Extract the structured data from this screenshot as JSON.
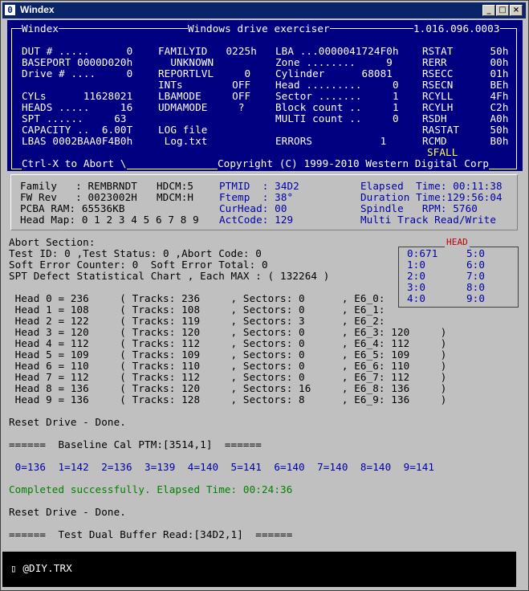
{
  "window": {
    "title": "Windex"
  },
  "header": {
    "app": "Windex",
    "subtitle": "Windows drive exerciser",
    "version": "1.016.096.0003",
    "footer_left": "Ctrl-X to Abort \\",
    "footer_right": "Copyright (C) 1999-2010 Western Digital Corp"
  },
  "blue_rows": [
    [
      "DUT # .....      0",
      "FAMILYID   0225h",
      "LBA ...0000041724F0h",
      "RSTAT      50h"
    ],
    [
      "BASEPORT 0000D020h",
      "  UNKNOWN",
      "Zone ........     9",
      "RERR       00h"
    ],
    [
      "Drive # ....     0",
      "REPORTLVL     0",
      "Cylinder      68081",
      "RSECC      01h"
    ],
    [
      "",
      "INTs        OFF",
      "Head .........     0",
      "RSECN      BEh"
    ],
    [
      "CYLs      11628021",
      "LBAMODE     OFF",
      "Sector .......     1",
      "RCYLL      4Fh"
    ],
    [
      "HEADS .....     16",
      "UDMAMODE     ?",
      "Block count ..     1",
      "RCYLH      C2h"
    ],
    [
      "SPT ......     63",
      "",
      "MULTI count ..     0",
      "RSDH       A0h"
    ],
    [
      "CAPACITY ..  6.00T",
      "LOG file",
      "",
      "RASTAT     50h"
    ],
    [
      "LBAS 0002BAA0F4B0h",
      " Log.txt",
      "ERRORS           1",
      "RCMD       B0h"
    ]
  ],
  "sfall": "SFALL",
  "info": {
    "col1": [
      "Family   : REMBRNDT",
      "FW Rev   : 0023002H",
      "PCBA RAM: 65536KB"
    ],
    "col2": [
      "HDCM:5",
      "MDCM:H",
      ""
    ],
    "col3": [
      "PTMID  : 34D2",
      "Ftemp  : 38°",
      "CurHead: 00"
    ],
    "col4": [
      "Elapsed  Time: 00:11:38",
      "Duration Time:129:56:04",
      "Spindle   RPM: 5760"
    ],
    "head_map": "Head Map: 0 1 2 3 4 5 6 7 8 9",
    "act_code": "ActCode: 129",
    "mode": "Multi Track Read/Write"
  },
  "abort": [
    "Abort Section:",
    "Test ID: 0 ,Test Status: 0 ,Abort Code: 0",
    "Soft Error Counter: 0  Soft Error Total: 0",
    "SPT Defect Statistical Chart , Each MAX : ( 132264 )"
  ],
  "head_box": {
    "title": "HEAD",
    "left": [
      "0:671",
      "1:0",
      "2:0",
      "3:0",
      "4:0"
    ],
    "right": [
      "5:0",
      "6:0",
      "7:0",
      "8:0",
      "9:0"
    ]
  },
  "head_rows": [
    " Head 0 = 236     ( Tracks: 236     , Sectors: 0      , E6_0:",
    " Head 1 = 108     ( Tracks: 108     , Sectors: 0      , E6_1:",
    " Head 2 = 122     ( Tracks: 119     , Sectors: 3      , E6_2:",
    " Head 3 = 120     ( Tracks: 120     , Sectors: 0      , E6_3: 120     )",
    " Head 4 = 112     ( Tracks: 112     , Sectors: 0      , E6_4: 112     )",
    " Head 5 = 109     ( Tracks: 109     , Sectors: 0      , E6_5: 109     )",
    " Head 6 = 110     ( Tracks: 110     , Sectors: 0      , E6_6: 110     )",
    " Head 7 = 112     ( Tracks: 112     , Sectors: 0      , E6_7: 112     )",
    " Head 8 = 136     ( Tracks: 120     , Sectors: 16     , E6_8: 136     )",
    " Head 9 = 136     ( Tracks: 128     , Sectors: 8      , E6_9: 136     )"
  ],
  "log": [
    {
      "text": "Reset Drive - Done.",
      "color": "k"
    },
    {
      "text": "======  Baseline Cal PTM:[3514,1]  ======",
      "color": "k"
    },
    {
      "text": " 0=136  1=142  2=136  3=139  4=140  5=141  6=140  7=140  8=140  9=141",
      "color": "b"
    },
    {
      "text": "Completed successfully. Elapsed Time: 00:24:36",
      "color": "g"
    },
    {
      "text": "Reset Drive - Done.",
      "color": "k"
    },
    {
      "text": "======  Test Dual Buffer Read:[34D2,1]  ======",
      "color": "k"
    }
  ],
  "prompt": "▯ @DIY.TRX"
}
